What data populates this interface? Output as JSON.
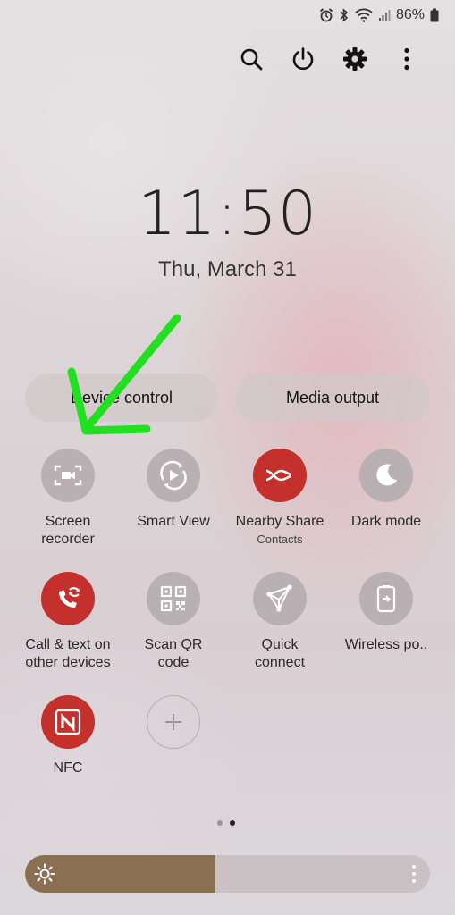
{
  "status": {
    "battery_percent": "86%"
  },
  "top_actions": [
    "search-icon",
    "power-icon",
    "gear-icon",
    "more-vertical-icon"
  ],
  "clock": {
    "time": "11:50",
    "date": "Thu, March 31"
  },
  "pills": {
    "device_control": "Device control",
    "media_output": "Media output"
  },
  "tiles": [
    {
      "label": "Screen\nrecorder",
      "sub": "",
      "state": "off",
      "icon": "screen-recorder-icon"
    },
    {
      "label": "Smart View",
      "sub": "",
      "state": "off",
      "icon": "smart-view-icon"
    },
    {
      "label": "Nearby Share",
      "sub": "Contacts",
      "state": "on",
      "icon": "nearby-share-icon"
    },
    {
      "label": "Dark mode",
      "sub": "",
      "state": "off",
      "icon": "moon-icon"
    },
    {
      "label": "Call & text on\nother devices",
      "sub": "",
      "state": "on",
      "icon": "call-sync-icon"
    },
    {
      "label": "Scan QR\ncode",
      "sub": "",
      "state": "off",
      "icon": "qr-code-icon"
    },
    {
      "label": "Quick\nconnect",
      "sub": "",
      "state": "off",
      "icon": "quick-connect-icon"
    },
    {
      "label": "Wireless po..",
      "sub": "",
      "state": "off",
      "icon": "wireless-power-icon"
    },
    {
      "label": "NFC",
      "sub": "",
      "state": "on",
      "icon": "nfc-icon"
    },
    {
      "label": "",
      "sub": "",
      "state": "add",
      "icon": "plus-icon"
    }
  ],
  "pager": {
    "pages": 2,
    "active": 2
  },
  "brightness": {
    "level": 0.47
  },
  "colors": {
    "tile_on": "#c4302b",
    "tile_off": "#b8b0b2",
    "brightness_fill": "#8a6f52",
    "annotation_arrow": "#22e01f"
  }
}
